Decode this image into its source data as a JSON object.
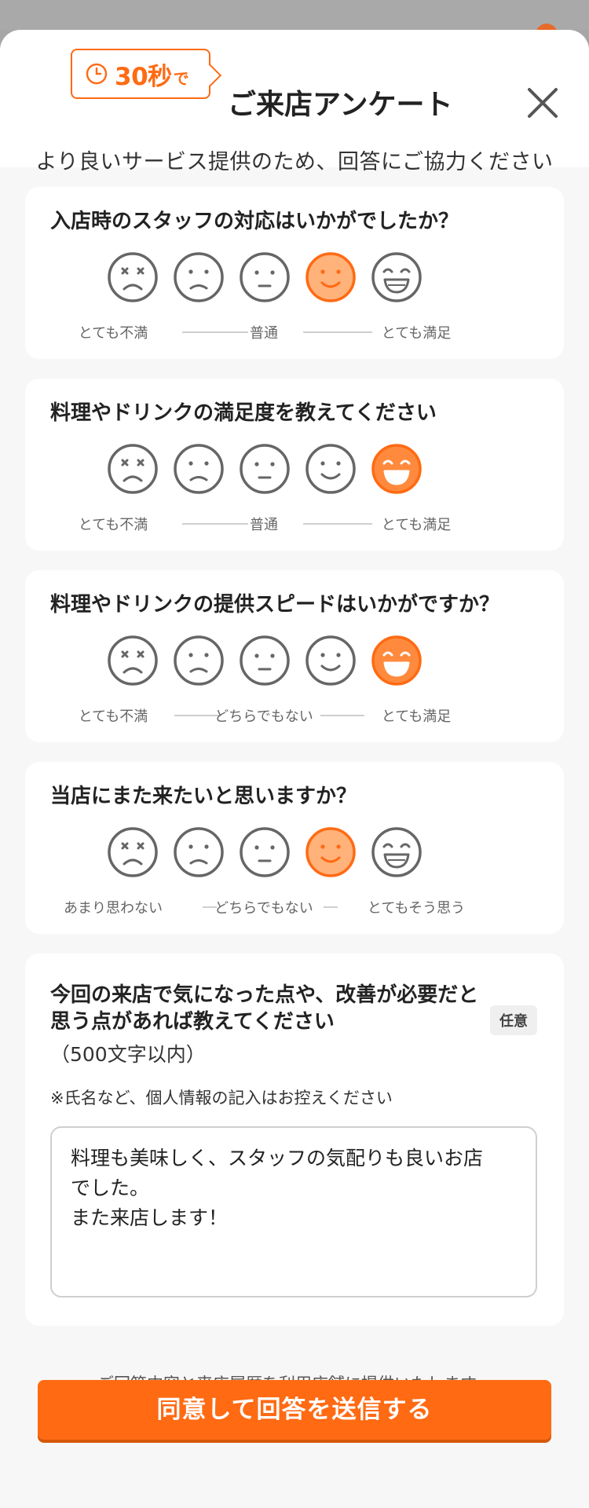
{
  "header": {
    "badge_number": "30秒",
    "badge_suffix": "で",
    "title": "ご来店アンケート",
    "subtitle": "より良いサービス提供のため、回答にご協力ください"
  },
  "questions": [
    {
      "title": "入店時のスタッフの対応はいかがでしたか？",
      "scale": [
        "とても不満",
        "普通",
        "とても満足"
      ],
      "selected": 4
    },
    {
      "title": "料理やドリンクの満足度を教えてください",
      "scale": [
        "とても不満",
        "普通",
        "とても満足"
      ],
      "selected": 5
    },
    {
      "title": "料理やドリンクの提供スピードはいかがですか？",
      "scale": [
        "とても不満",
        "どちらでもない",
        "とても満足"
      ],
      "selected": 5
    },
    {
      "title": "当店にまた来たいと思いますか？",
      "scale": [
        "あまり思わない",
        "どちらでもない",
        "とてもそう思う"
      ],
      "selected": 4
    }
  ],
  "free_text": {
    "title": "今回の来店で気になった点や、改善が必要だと思う点があれば教えてください",
    "limit": "（500文字以内）",
    "optional_badge": "任意",
    "note": "※氏名など、個人情報の記入はお控えください",
    "value": "料理も美味しく、スタッフの気配りも良いお店\nでした。\nまた来店します！"
  },
  "footer": {
    "disclaimer": "ご回答内容と来店履歴を利用店舗に提供いたします。",
    "submit_label": "同意して回答を送信する"
  },
  "colors": {
    "accent": "#ff6a13",
    "selected_face_fill": "#ff8a3d",
    "selected_face_light": "#ffb27a",
    "face_outline": "#666666"
  },
  "face_icons": [
    "very-dissatisfied-face-icon",
    "dissatisfied-face-icon",
    "neutral-face-icon",
    "satisfied-face-icon",
    "very-satisfied-face-icon"
  ]
}
